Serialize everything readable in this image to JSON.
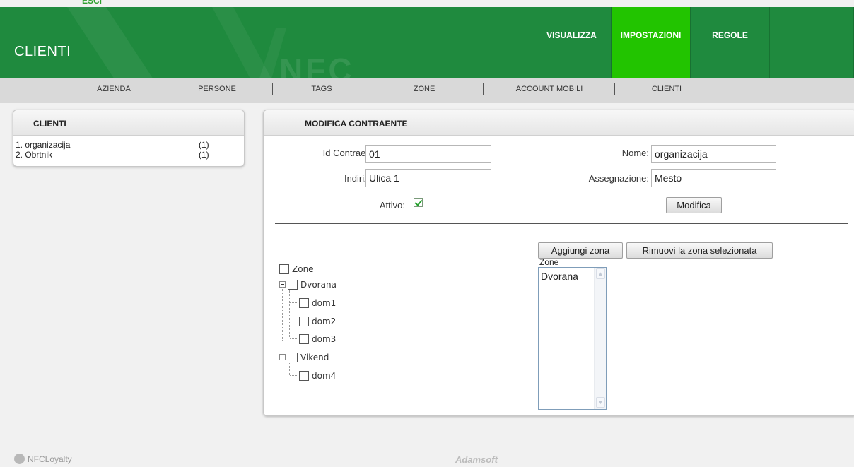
{
  "header": {
    "app_title": "CLIENTI",
    "watermark": "NFC",
    "top_link": "ESCI",
    "nav": [
      {
        "label": "VISUALIZZA",
        "active": false
      },
      {
        "label": "IMPOSTAZIONI",
        "active": true
      },
      {
        "label": "REGOLE",
        "active": false
      }
    ],
    "accent_color": "#1f8a3e",
    "active_color": "#22c400"
  },
  "subnav": {
    "items": [
      "AZIENDA",
      "PERSONE",
      "TAGS",
      "ZONE",
      "ACCOUNT MOBILI",
      "CLIENTI"
    ]
  },
  "clients_panel": {
    "title": "CLIENTI",
    "items": [
      {
        "label": "1. organizacija",
        "count": "(1)"
      },
      {
        "label": "2. Obrtnik",
        "count": "(1)"
      }
    ]
  },
  "edit_panel": {
    "title": "MODIFICA CONTRAENTE",
    "id_label": "Id Contraente:",
    "id_value": "01",
    "address_label": "Indirizzo:",
    "address_value": "Ulica 1",
    "name_label": "Nome:",
    "name_value": "organizacija",
    "assignment_label": "Assegnazione:",
    "assignment_value": "Mesto",
    "active_label": "Attivo:",
    "active_checked": true,
    "modify_button": "Modifica",
    "add_zone_button": "Aggiungi zona",
    "remove_zone_button": "Rimuovi la zona selezionata",
    "zone_list_label": "Zone",
    "zone_list_items": [
      "Dvorana"
    ]
  },
  "tree": {
    "root": "Zone",
    "groups": [
      {
        "label": "Dvorana",
        "children": [
          "dom1",
          "dom2",
          "dom3"
        ]
      },
      {
        "label": "Vikend",
        "children": [
          "dom4"
        ]
      }
    ]
  },
  "footer": {
    "brand": "NFCLoyalty",
    "credit": "Adamsoft"
  }
}
